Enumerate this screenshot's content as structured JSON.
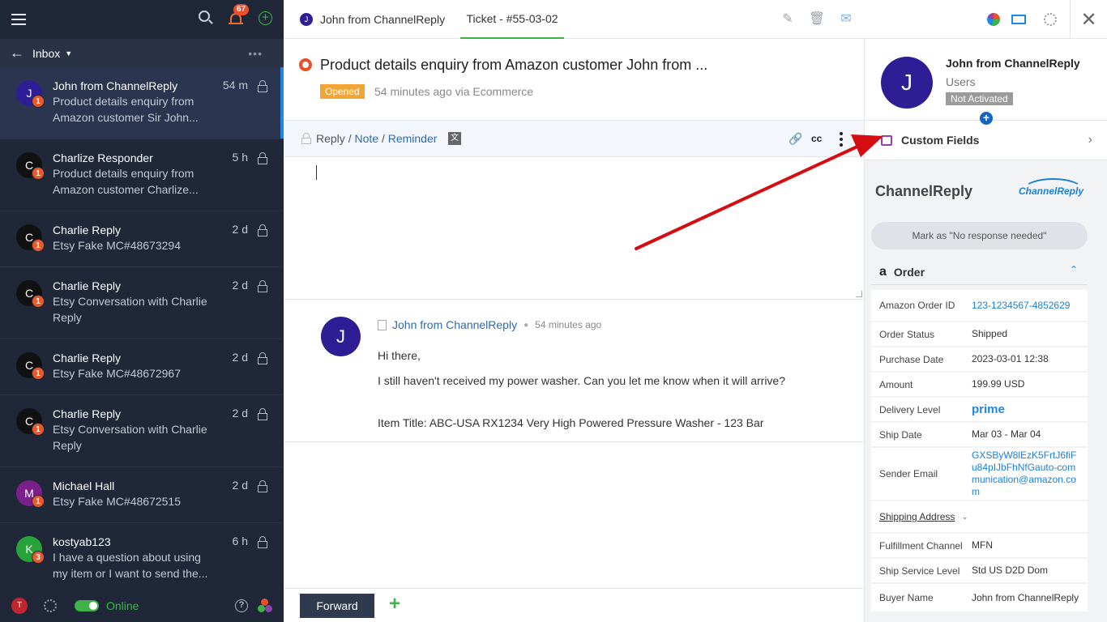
{
  "sidebar": {
    "notification_count": "67",
    "inbox_label": "Inbox",
    "conversations": [
      {
        "initial": "J",
        "badge": "1",
        "name": "John from ChannelReply",
        "time": "54 m",
        "preview1": "Product details enquiry from",
        "preview2": "Amazon customer Sir John...",
        "avatar_color": "#2d1e96"
      },
      {
        "initial": "C",
        "badge": "1",
        "name": "Charlize Responder",
        "time": "5 h",
        "preview1": "Product details enquiry from",
        "preview2": "Amazon customer Charlize...",
        "avatar_color": "#111111"
      },
      {
        "initial": "C",
        "badge": "1",
        "name": "Charlie Reply",
        "time": "2 d",
        "preview1": "Etsy Fake MC#48673294",
        "preview2": "",
        "avatar_color": "#111111"
      },
      {
        "initial": "C",
        "badge": "1",
        "name": "Charlie Reply",
        "time": "2 d",
        "preview1": "Etsy Conversation with Charlie",
        "preview2": "Reply",
        "avatar_color": "#111111"
      },
      {
        "initial": "C",
        "badge": "1",
        "name": "Charlie Reply",
        "time": "2 d",
        "preview1": "Etsy Fake MC#48672967",
        "preview2": "",
        "avatar_color": "#111111"
      },
      {
        "initial": "C",
        "badge": "1",
        "name": "Charlie Reply",
        "time": "2 d",
        "preview1": "Etsy Conversation with Charlie",
        "preview2": "Reply",
        "avatar_color": "#111111"
      },
      {
        "initial": "M",
        "badge": "1",
        "name": "Michael Hall",
        "time": "2 d",
        "preview1": "Etsy Fake MC#48672515",
        "preview2": "",
        "avatar_color": "#7b1f8a"
      },
      {
        "initial": "K",
        "badge": "3",
        "name": "kostyab123",
        "time": "6 h",
        "preview1": "I have a question about using",
        "preview2": "my item or I want to send the...",
        "avatar_color": "#27a33a"
      }
    ],
    "user_initial": "T",
    "status_label": "Online"
  },
  "topbar": {
    "tab1_initial": "J",
    "tab1_label": "John from ChannelReply",
    "tab2_label": "Ticket - #55-03-02"
  },
  "ticket": {
    "title": "Product details enquiry from Amazon customer John from ...",
    "status": "Opened",
    "meta": "54 minutes ago via Ecommerce"
  },
  "reply": {
    "mode_reply": "Reply",
    "sep": "/",
    "mode_note": "Note",
    "mode_reminder": "Reminder",
    "cc": "cc"
  },
  "message": {
    "avatar_initial": "J",
    "sender": "John from ChannelReply",
    "time": "54 minutes ago",
    "line1": "Hi there,",
    "line2": "I still haven't received my power washer. Can you let me know when it will arrive?",
    "line3": "Item Title: ABC-USA RX1234 Very High Powered Pressure Washer - 123 Bar"
  },
  "footer": {
    "forward_label": "Forward"
  },
  "panel": {
    "avatar_initial": "J",
    "name": "John from ChannelReply",
    "group": "Users",
    "status": "Not Activated",
    "custom_fields_label": "Custom Fields",
    "brand": "ChannelReply",
    "logo_text": "ChannelReply",
    "mark_button": "Mark as \"No response needed\"",
    "order_label": "Order",
    "fields": [
      {
        "key": "Amazon Order ID",
        "value": "123-1234567-4852629",
        "link": true
      },
      {
        "key": "Order Status",
        "value": "Shipped",
        "link": false
      },
      {
        "key": "Purchase Date",
        "value": "2023-03-01 12:38",
        "link": false
      },
      {
        "key": "Amount",
        "value": "199.99 USD",
        "link": false
      },
      {
        "key": "Delivery Level",
        "value": "prime",
        "link": false
      },
      {
        "key": "Ship Date",
        "value": "Mar 03 - Mar 04",
        "link": false
      },
      {
        "key": "Sender Email",
        "value": "GXSByW8lEzK5FrtJ6fiFu84pIJbFhNfGauto-communication@amazon.com",
        "link": true
      }
    ],
    "shipping_address_label": "Shipping Address",
    "fields2": [
      {
        "key": "Fulfillment Channel",
        "value": "MFN"
      },
      {
        "key": "Ship Service Level",
        "value": "Std US D2D Dom"
      },
      {
        "key": "Buyer Name",
        "value": "John from ChannelReply"
      }
    ]
  }
}
